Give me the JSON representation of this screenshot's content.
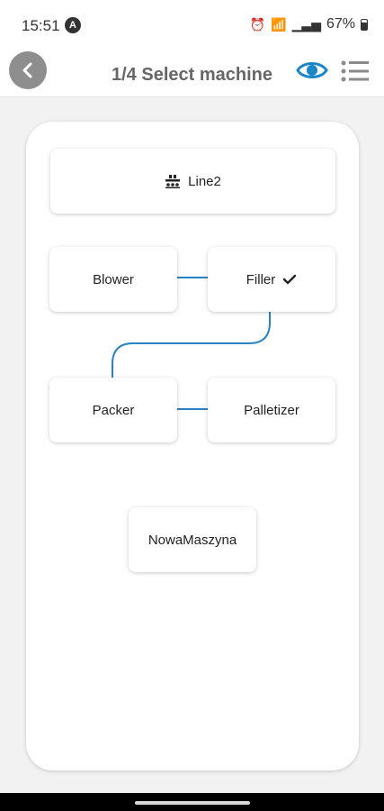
{
  "status_bar": {
    "time": "15:51",
    "app_icon_letter": "A",
    "battery": "67%",
    "icons": [
      "alarm-icon",
      "wifi-call-icon",
      "signal-icon",
      "battery-icon"
    ]
  },
  "app_bar": {
    "title": "1/4 Select machine",
    "accent_color": "#1a86c6"
  },
  "line": {
    "label": "Line2",
    "icon": "conveyor-line-icon"
  },
  "machines": [
    {
      "label": "Blower",
      "selected": false
    },
    {
      "label": "Filler",
      "selected": true
    },
    {
      "label": "Packer",
      "selected": false
    },
    {
      "label": "Palletizer",
      "selected": false
    },
    {
      "label": "NowaMaszyna",
      "selected": false
    }
  ],
  "connector_color": "#2a82c4"
}
